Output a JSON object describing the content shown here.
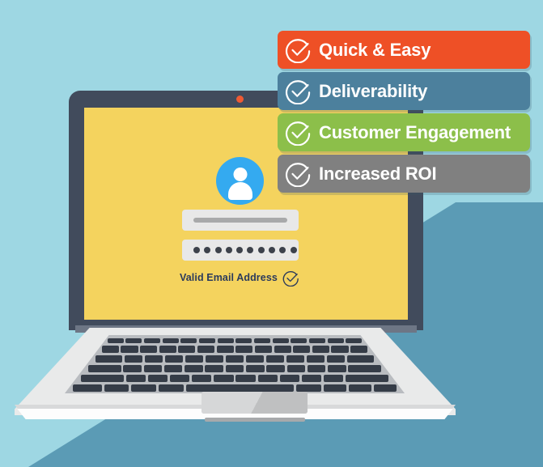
{
  "illustration": {
    "title": "Email validation laptop illustration",
    "background_color": "#9ed7e3",
    "shadow_color": "#5b9bb5"
  },
  "device": {
    "name": "laptop",
    "bezel_color": "#414b5c",
    "screen_color": "#f4d35e",
    "body_color": "#e9eaea",
    "camera_color": "#ef5a33",
    "keyboard_key_color": "#353c47",
    "keyboard_rows": 5
  },
  "login_form": {
    "avatar_icon": "user-avatar-icon",
    "avatar_color": "#34aaf0",
    "username_value": "",
    "username_placeholder": "",
    "password_value": "••••••••••",
    "password_dot_count": 10,
    "status_text": "Valid Email Address",
    "status_text_color": "#2b3a5c",
    "status_icon": "check-circle-icon"
  },
  "benefits": {
    "items": [
      {
        "label": "Quick & Easy",
        "color": "#ee5026",
        "icon": "check-circle-icon"
      },
      {
        "label": "Deliverability",
        "color": "#4c809d",
        "icon": "check-circle-icon"
      },
      {
        "label": "Customer Engagement",
        "color": "#8cbf4a",
        "icon": "check-circle-icon"
      },
      {
        "label": "Increased ROI",
        "color": "#808080",
        "icon": "check-circle-icon"
      }
    ]
  }
}
